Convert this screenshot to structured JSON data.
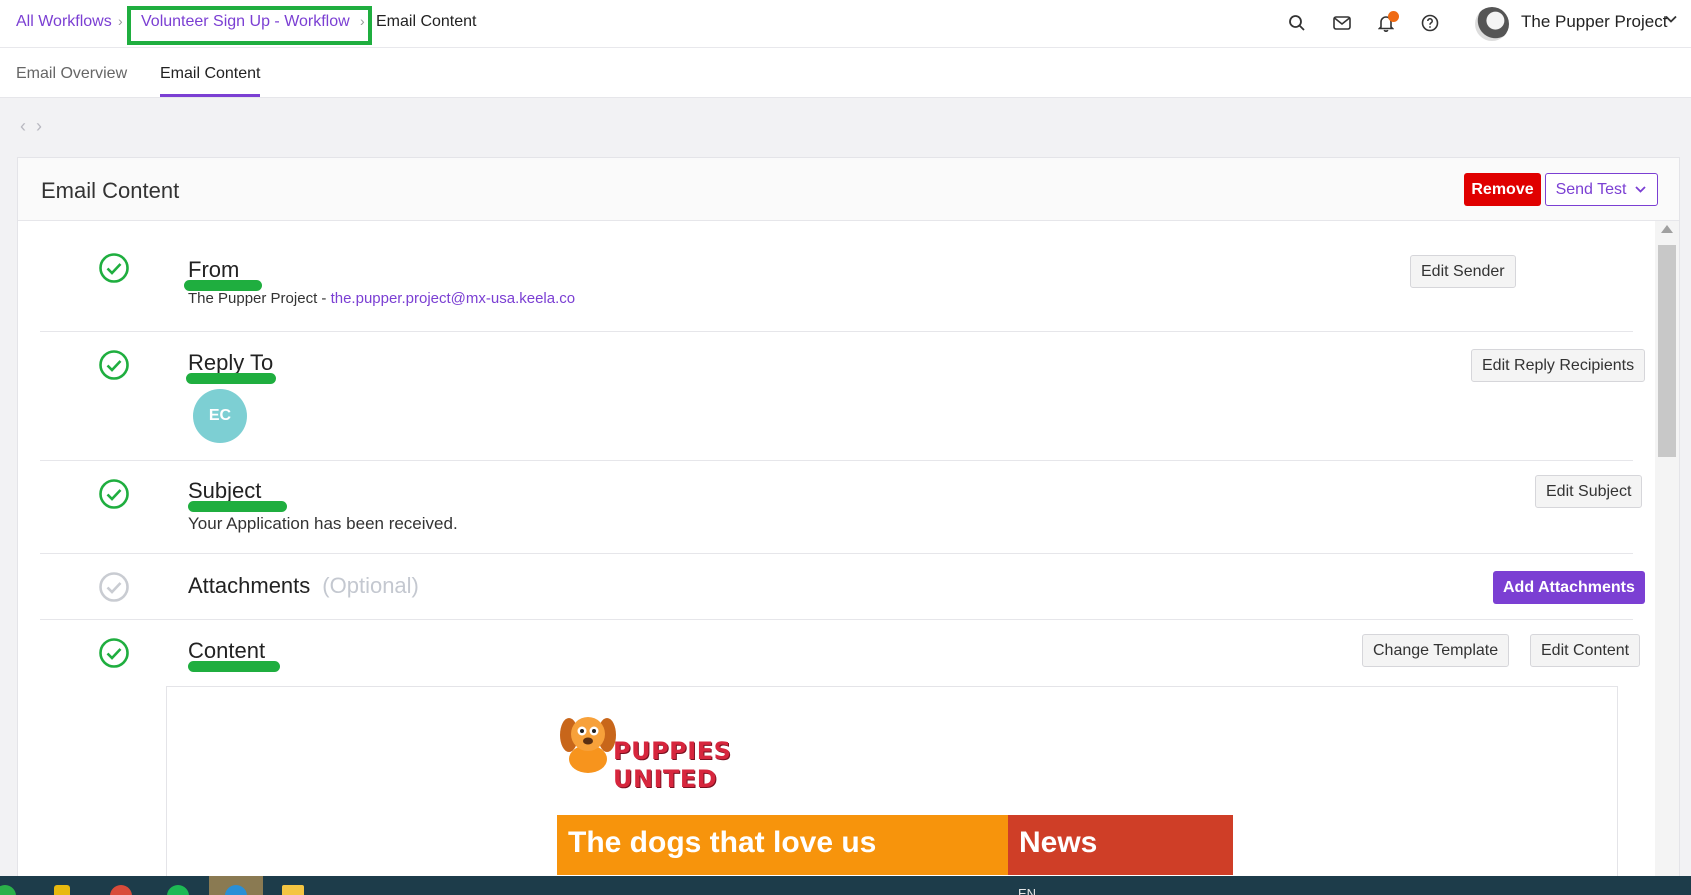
{
  "breadcrumb": {
    "items": [
      "All Workflows",
      "Volunteer Sign Up - Workflow",
      "Email Content"
    ],
    "separator": "›"
  },
  "header": {
    "org_name": "The Pupper Project"
  },
  "tabs": [
    {
      "label": "Email Overview",
      "active": false
    },
    {
      "label": "Email Content",
      "active": true
    }
  ],
  "card": {
    "title": "Email Content",
    "remove_label": "Remove",
    "send_test_label": "Send Test"
  },
  "sections": {
    "from": {
      "title": "From",
      "sender_name": "The Pupper Project - ",
      "sender_email": "the.pupper.project@mx-usa.keela.co",
      "button": "Edit Sender",
      "status": "complete"
    },
    "reply_to": {
      "title": "Reply To",
      "recipient_initials": "EC",
      "button": "Edit Reply Recipients",
      "status": "complete"
    },
    "subject": {
      "title": "Subject",
      "value": "Your Application has been received.",
      "button": "Edit Subject",
      "status": "complete"
    },
    "attachments": {
      "title": "Attachments",
      "optional_label": "(Optional)",
      "button": "Add Attachments",
      "status": "incomplete"
    },
    "content": {
      "title": "Content",
      "change_template_label": "Change Template",
      "edit_content_label": "Edit Content",
      "status": "complete"
    }
  },
  "preview": {
    "logo_text": "PUPPIES UNITED",
    "banner_left": "The dogs that love us",
    "banner_right": "News"
  },
  "taskbar": {
    "language": "EN"
  },
  "colors": {
    "accent": "#7b3fd3",
    "danger": "#e00000",
    "success": "#1fae3f",
    "highlight": "#1fae3f",
    "notification": "#ef6a13",
    "banner_orange": "#f7940c",
    "banner_red": "#cf3e27",
    "avatar_teal": "#7dcfd3"
  },
  "icons": {
    "top": [
      "search-icon",
      "mail-icon",
      "bell-icon",
      "help-icon",
      "chevron-down-icon"
    ],
    "status": [
      "check-circle-icon"
    ]
  }
}
